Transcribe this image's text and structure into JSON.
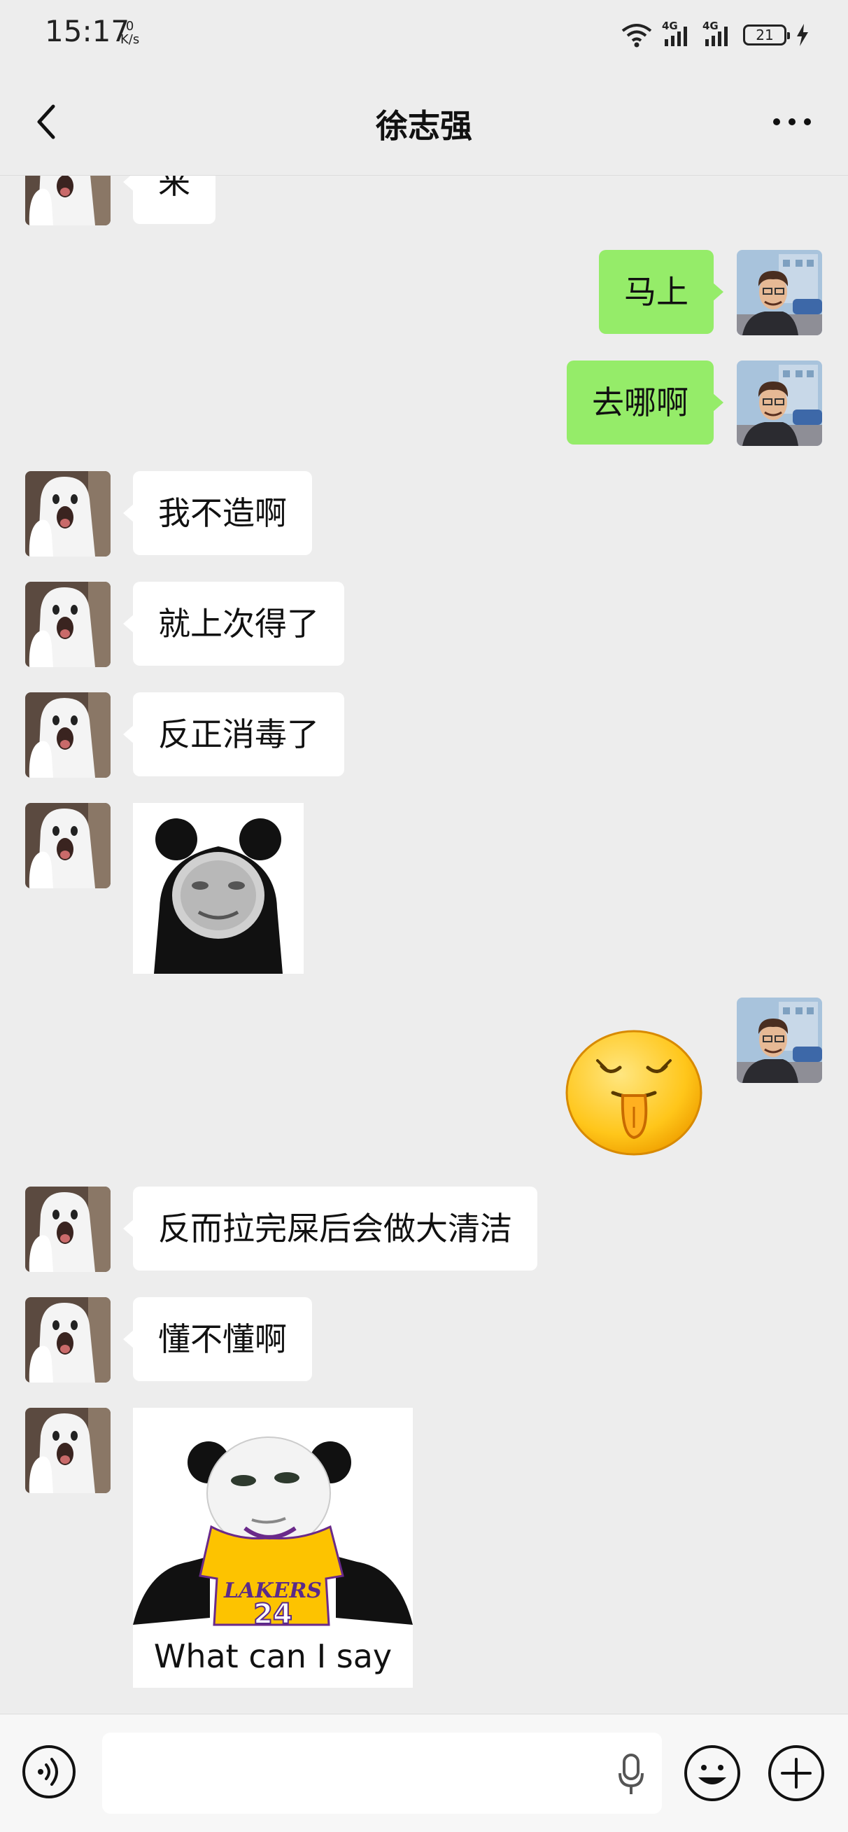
{
  "status_bar": {
    "time": "15:17",
    "net_speed_value": "0",
    "net_speed_unit": "K/s",
    "network_1": "4G",
    "network_2": "4G",
    "battery": "21"
  },
  "header": {
    "title": "徐志强",
    "back_icon": "chevron-left-icon",
    "more_icon": "more-dots-icon"
  },
  "messages": [
    {
      "side": "left",
      "type": "text",
      "text": "来"
    },
    {
      "side": "right",
      "type": "text",
      "text": "马上"
    },
    {
      "side": "right",
      "type": "text",
      "text": "去哪啊"
    },
    {
      "side": "left",
      "type": "text",
      "text": "我不造啊"
    },
    {
      "side": "left",
      "type": "text",
      "text": "就上次得了"
    },
    {
      "side": "left",
      "type": "text",
      "text": "反正消毒了"
    },
    {
      "side": "left",
      "type": "sticker",
      "sticker": "panda-head-sticker"
    },
    {
      "side": "right",
      "type": "sticker",
      "sticker": "tongue-out-emoji-sticker"
    },
    {
      "side": "left",
      "type": "text",
      "text": "反而拉完屎后会做大清洁"
    },
    {
      "side": "left",
      "type": "text",
      "text": "懂不懂啊"
    },
    {
      "side": "left",
      "type": "sticker",
      "sticker": "panda-lakers-jersey-sticker",
      "jersey_team": "LAKERS",
      "jersey_number": "24",
      "caption": "What can I say"
    }
  ],
  "input_bar": {
    "voice_icon": "voice-icon",
    "mic_icon": "microphone-icon",
    "emoji_icon": "emoji-icon",
    "plus_icon": "plus-icon"
  },
  "colors": {
    "background": "#ededed",
    "sent_bubble": "#95ec69",
    "received_bubble": "#ffffff"
  }
}
